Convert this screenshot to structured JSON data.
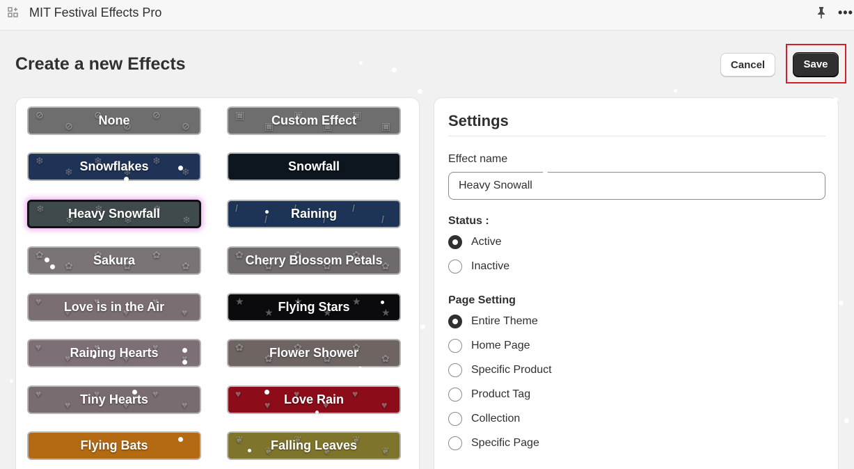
{
  "app": {
    "title": "MIT Festival Effects Pro"
  },
  "page": {
    "title": "Create a new Effects"
  },
  "actions": {
    "cancel_label": "Cancel",
    "save_label": "Save"
  },
  "effects": [
    {
      "label": "None",
      "bg": "#6e6e6e",
      "selected": false
    },
    {
      "label": "Custom Effect",
      "bg": "#6e6e6e",
      "selected": false
    },
    {
      "label": "Snowflakes",
      "bg": "#1f3357",
      "selected": false
    },
    {
      "label": "Snowfall",
      "bg": "#0d151f",
      "selected": false
    },
    {
      "label": "Heavy Snowfall",
      "bg": "#3f4a4c",
      "selected": true
    },
    {
      "label": "Raining",
      "bg": "#1d3456",
      "selected": false
    },
    {
      "label": "Sakura",
      "bg": "#7a7476",
      "selected": false
    },
    {
      "label": "Cherry Blossom Petals",
      "bg": "#6f6a6b",
      "selected": false
    },
    {
      "label": "Love is in the Air",
      "bg": "#7a6e72",
      "selected": false
    },
    {
      "label": "Flying Stars",
      "bg": "#0b0b0d",
      "selected": false
    },
    {
      "label": "Raining Hearts",
      "bg": "#7d6f76",
      "selected": false
    },
    {
      "label": "Flower Shower",
      "bg": "#6e6563",
      "selected": false
    },
    {
      "label": "Tiny Hearts",
      "bg": "#786c71",
      "selected": false
    },
    {
      "label": "Love Rain",
      "bg": "#8c0c1a",
      "selected": false
    },
    {
      "label": "Flying Bats",
      "bg": "#b36a12",
      "selected": false
    },
    {
      "label": "Falling Leaves",
      "bg": "#7f742c",
      "selected": false
    }
  ],
  "settings": {
    "title": "Settings",
    "effect_name_label": "Effect name",
    "effect_name_value": "Heavy Snowall",
    "status": {
      "label": "Status :",
      "options": [
        {
          "label": "Active",
          "checked": true
        },
        {
          "label": "Inactive",
          "checked": false
        }
      ]
    },
    "page_setting": {
      "label": "Page Setting",
      "options": [
        {
          "label": "Entire Theme",
          "checked": true
        },
        {
          "label": "Home Page",
          "checked": false
        },
        {
          "label": "Specific Product",
          "checked": false
        },
        {
          "label": "Product Tag",
          "checked": false
        },
        {
          "label": "Collection",
          "checked": false
        },
        {
          "label": "Specific Page",
          "checked": false
        }
      ]
    }
  },
  "colors": {
    "save_highlight": "#d0202a",
    "primary_button": "#303030",
    "page_bg": "#f1f1f1"
  }
}
